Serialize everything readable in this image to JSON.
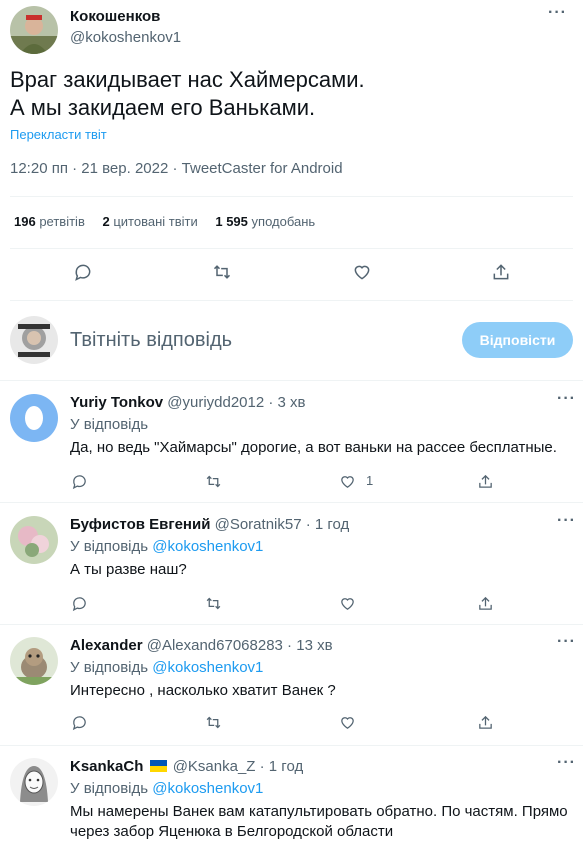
{
  "tweet": {
    "author_name": "Кокошенков",
    "author_handle": "@kokoshenkov1",
    "text_line1": "Враг закидывает нас Хаймерсами.",
    "text_line2": "А мы закидаем его Ваньками.",
    "translate_label": "Перекласти твіт",
    "meta": "12:20 пп · 21 вер. 2022 · TweetCaster for Android",
    "retweets_count": "196",
    "retweets_label": "ретвітів",
    "quotes_count": "2",
    "quotes_label": "цитовані твіти",
    "likes_count": "1 595",
    "likes_label": "уподобань"
  },
  "reply_composer": {
    "placeholder": "Твітніть відповідь",
    "button_label": "Відповісти"
  },
  "replies": [
    {
      "name": "Yuriy Tonkov",
      "handle": "@yuriydd2012 · 3 хв",
      "reply_to_prefix": "У відповідь",
      "reply_to_handle": "",
      "text": "Да, но ведь \"Хаймарсы\" дорогие, а вот ваньки на рассее бесплатные.",
      "like_count": "1"
    },
    {
      "name": "Буфистов Евгений",
      "handle": "@Soratnik57 · 1 год",
      "reply_to_prefix": "У відповідь",
      "reply_to_handle": "@kokoshenkov1",
      "text": "А ты разве наш?",
      "like_count": ""
    },
    {
      "name": "Alexander",
      "handle": "@Alexand67068283 · 13 хв",
      "reply_to_prefix": "У відповідь",
      "reply_to_handle": "@kokoshenkov1",
      "text": "Интересно , насколько хватит Ванек ?",
      "like_count": ""
    },
    {
      "name": "KsankaCh",
      "handle": "@Ksanka_Z · 1 год",
      "reply_to_prefix": "У відповідь",
      "reply_to_handle": "@kokoshenkov1",
      "text": "Мы намерены Ванек вам катапультировать обратно. По частям. Прямо через забор Яценюка в Белгородской области",
      "like_count": ""
    }
  ],
  "icons": {
    "more": "more-horizontal-icon",
    "reply": "reply-bubble-icon",
    "retweet": "retweet-icon",
    "like": "heart-icon",
    "share": "share-icon",
    "flag": "ukraine-flag-icon"
  },
  "colors": {
    "accent": "#1d9bf0",
    "button_disabled": "#8ecdf8",
    "muted": "#536471",
    "divider": "#eff3f4"
  }
}
